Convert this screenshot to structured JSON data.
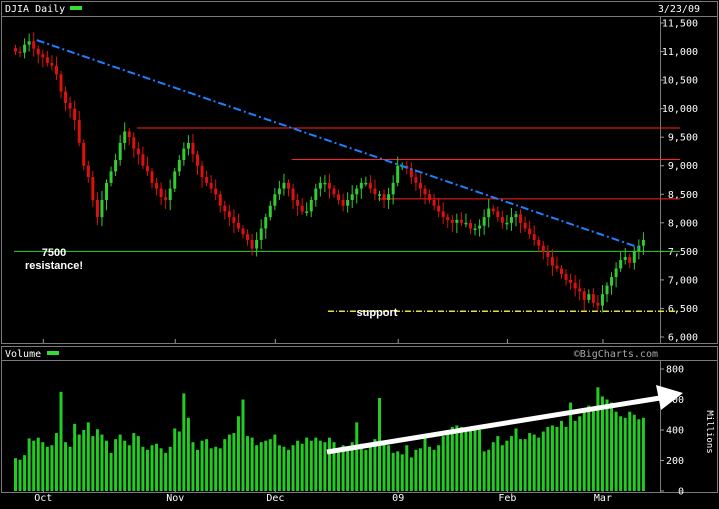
{
  "header": {
    "title": "DJIA Daily",
    "date": "3/23/09"
  },
  "volume_panel": {
    "title": "Volume",
    "watermark": "©BigCharts.com",
    "unit_label": "Millions"
  },
  "colors": {
    "background": "#000000",
    "frame": "#7a7a7a",
    "up": "#33cc33",
    "down": "#dd1111",
    "trendline": "#1e7fff",
    "resistance": "#ff2222",
    "level7500": "#33cc33",
    "support": "#e8e040",
    "volume": "#22cc22",
    "arrow": "#ffffff",
    "legend_swatch": "#33dd33"
  },
  "chart_data": [
    {
      "type": "candlestick",
      "title": "DJIA Daily",
      "ylim": [
        6000,
        11600
      ],
      "y_ticks": [
        {
          "value": 11500,
          "label": "11,500"
        },
        {
          "value": 11000,
          "label": "11,000"
        },
        {
          "value": 10500,
          "label": "10,500"
        },
        {
          "value": 10000,
          "label": "10,000"
        },
        {
          "value": 9500,
          "label": "9,500"
        },
        {
          "value": 9000,
          "label": "9,000"
        },
        {
          "value": 8500,
          "label": "8,500"
        },
        {
          "value": 8000,
          "label": "8,000"
        },
        {
          "value": 7500,
          "label": "7,500"
        },
        {
          "value": 7000,
          "label": "7,000"
        },
        {
          "value": 6500,
          "label": "6,500"
        },
        {
          "value": 6000,
          "label": "6,000"
        }
      ],
      "x_ticks": [
        {
          "index": 6,
          "label": "Oct"
        },
        {
          "index": 35,
          "label": "Nov"
        },
        {
          "index": 57,
          "label": "Dec"
        },
        {
          "index": 84,
          "label": "09"
        },
        {
          "index": 108,
          "label": "Feb"
        },
        {
          "index": 129,
          "label": "Mar"
        }
      ],
      "closes": [
        11000,
        10980,
        11120,
        11180,
        11050,
        10950,
        10900,
        10800,
        10750,
        10600,
        10300,
        10100,
        10000,
        9800,
        9400,
        9000,
        8800,
        8400,
        8100,
        8400,
        8700,
        8900,
        9100,
        9400,
        9600,
        9500,
        9300,
        9200,
        9000,
        8900,
        8700,
        8600,
        8450,
        8400,
        8600,
        8900,
        9100,
        9300,
        9400,
        9200,
        9000,
        8800,
        8700,
        8600,
        8500,
        8300,
        8200,
        8100,
        8000,
        7900,
        7800,
        7700,
        7550,
        7700,
        7900,
        8100,
        8300,
        8500,
        8600,
        8700,
        8600,
        8400,
        8300,
        8200,
        8200,
        8400,
        8600,
        8700,
        8700,
        8600,
        8500,
        8400,
        8300,
        8400,
        8500,
        8600,
        8700,
        8700,
        8600,
        8500,
        8500,
        8400,
        8500,
        8700,
        9000,
        9000,
        8950,
        8800,
        8700,
        8600,
        8500,
        8400,
        8300,
        8200,
        8100,
        8050,
        8000,
        8050,
        8000,
        8000,
        7900,
        7900,
        7950,
        8100,
        8250,
        8200,
        8100,
        8000,
        8000,
        8100,
        8150,
        8000,
        7900,
        7800,
        7700,
        7600,
        7500,
        7400,
        7250,
        7200,
        7100,
        7000,
        6950,
        6850,
        6800,
        6650,
        6750,
        6600,
        6550,
        6750,
        6900,
        7050,
        7200,
        7350,
        7400,
        7300,
        7500,
        7600,
        7700
      ],
      "annotations": [
        {
          "text": "7500",
          "kind": "label"
        },
        {
          "text": "resistance!",
          "kind": "label"
        },
        {
          "text": "support",
          "kind": "label"
        }
      ],
      "levels": [
        {
          "name": "resistance-9660",
          "value": 9660,
          "x_start": 27
        },
        {
          "name": "resistance-9110",
          "value": 9110,
          "x_start": 61
        },
        {
          "name": "resistance-8420",
          "value": 8420,
          "x_start": 80
        },
        {
          "name": "level-7500",
          "value": 7500,
          "x_start": 0
        },
        {
          "name": "support-6450",
          "value": 6450,
          "x_start": 69
        }
      ],
      "trendline": {
        "from": [
          5,
          11200
        ],
        "to": [
          138,
          7550
        ]
      }
    },
    {
      "type": "bar",
      "title": "Volume",
      "ylabel": "Millions",
      "ylim": [
        0,
        800
      ],
      "y_ticks": [
        {
          "value": 800,
          "label": "800"
        },
        {
          "value": 600,
          "label": "600"
        },
        {
          "value": 400,
          "label": "400"
        },
        {
          "value": 200,
          "label": "200"
        },
        {
          "value": 0,
          "label": "0"
        }
      ],
      "values": [
        215,
        205,
        235,
        345,
        330,
        350,
        320,
        290,
        300,
        380,
        650,
        320,
        290,
        440,
        370,
        400,
        450,
        360,
        405,
        370,
        330,
        250,
        340,
        370,
        330,
        300,
        380,
        360,
        290,
        270,
        300,
        310,
        280,
        250,
        290,
        410,
        390,
        640,
        480,
        320,
        270,
        330,
        340,
        280,
        290,
        280,
        340,
        370,
        380,
        490,
        600,
        360,
        350,
        300,
        320,
        330,
        340,
        370,
        300,
        290,
        270,
        300,
        330,
        310,
        350,
        330,
        350,
        330,
        320,
        350,
        320,
        280,
        300,
        290,
        320,
        450,
        310,
        270,
        310,
        340,
        610,
        320,
        300,
        250,
        260,
        240,
        300,
        220,
        270,
        280,
        350,
        290,
        270,
        300,
        360,
        400,
        420,
        430,
        420,
        410,
        400,
        420,
        400,
        260,
        270,
        320,
        360,
        300,
        330,
        360,
        410,
        340,
        340,
        380,
        370,
        350,
        390,
        420,
        430,
        420,
        460,
        420,
        580,
        460,
        490,
        530,
        560,
        540,
        680,
        620,
        600,
        580,
        520,
        490,
        480,
        520,
        500,
        470,
        480
      ]
    }
  ]
}
